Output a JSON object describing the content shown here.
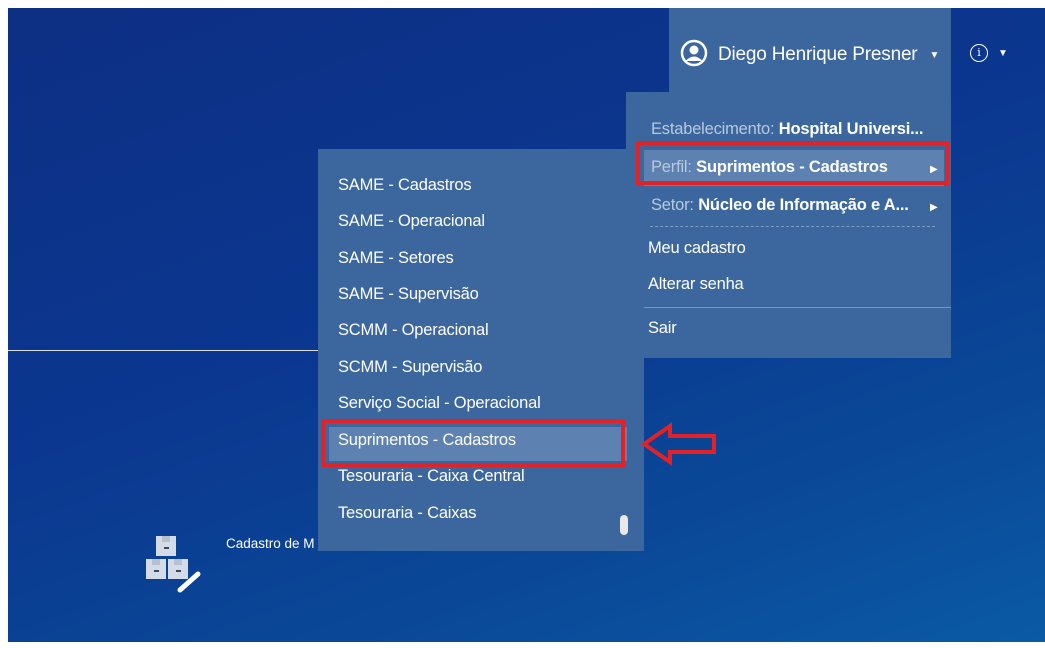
{
  "header": {
    "user_name": "Diego Henrique Presner",
    "user_icon": "user-circle-icon",
    "info_icon": "info-circle-icon"
  },
  "user_menu": {
    "estabelecimento": {
      "key": "Estabelecimento:",
      "value": "Hospital Universi..."
    },
    "perfil": {
      "key": "Perfil:",
      "value": "Suprimentos - Cadastros"
    },
    "setor": {
      "key": "Setor:",
      "value": "Núcleo de Informação e A..."
    },
    "meu_cadastro": "Meu cadastro",
    "alterar_senha": "Alterar senha",
    "sair": "Sair"
  },
  "perfil_menu": {
    "items": [
      "SAME - Cadastros",
      "SAME - Operacional",
      "SAME - Setores",
      "SAME - Supervisão",
      "SCMM - Operacional",
      "SCMM - Supervisão",
      "Serviço Social - Operacional",
      "Suprimentos - Cadastros",
      "Tesouraria - Caixa Central",
      "Tesouraria - Caixas"
    ],
    "selected": "Suprimentos - Cadastros"
  },
  "desktop": {
    "item_label": "Cadastro de M",
    "item_icon": "boxes-edit-icon"
  },
  "colors": {
    "highlight": "#e32227",
    "menu_bg": "#3c679e",
    "menu_selected": "#5d82b1"
  }
}
